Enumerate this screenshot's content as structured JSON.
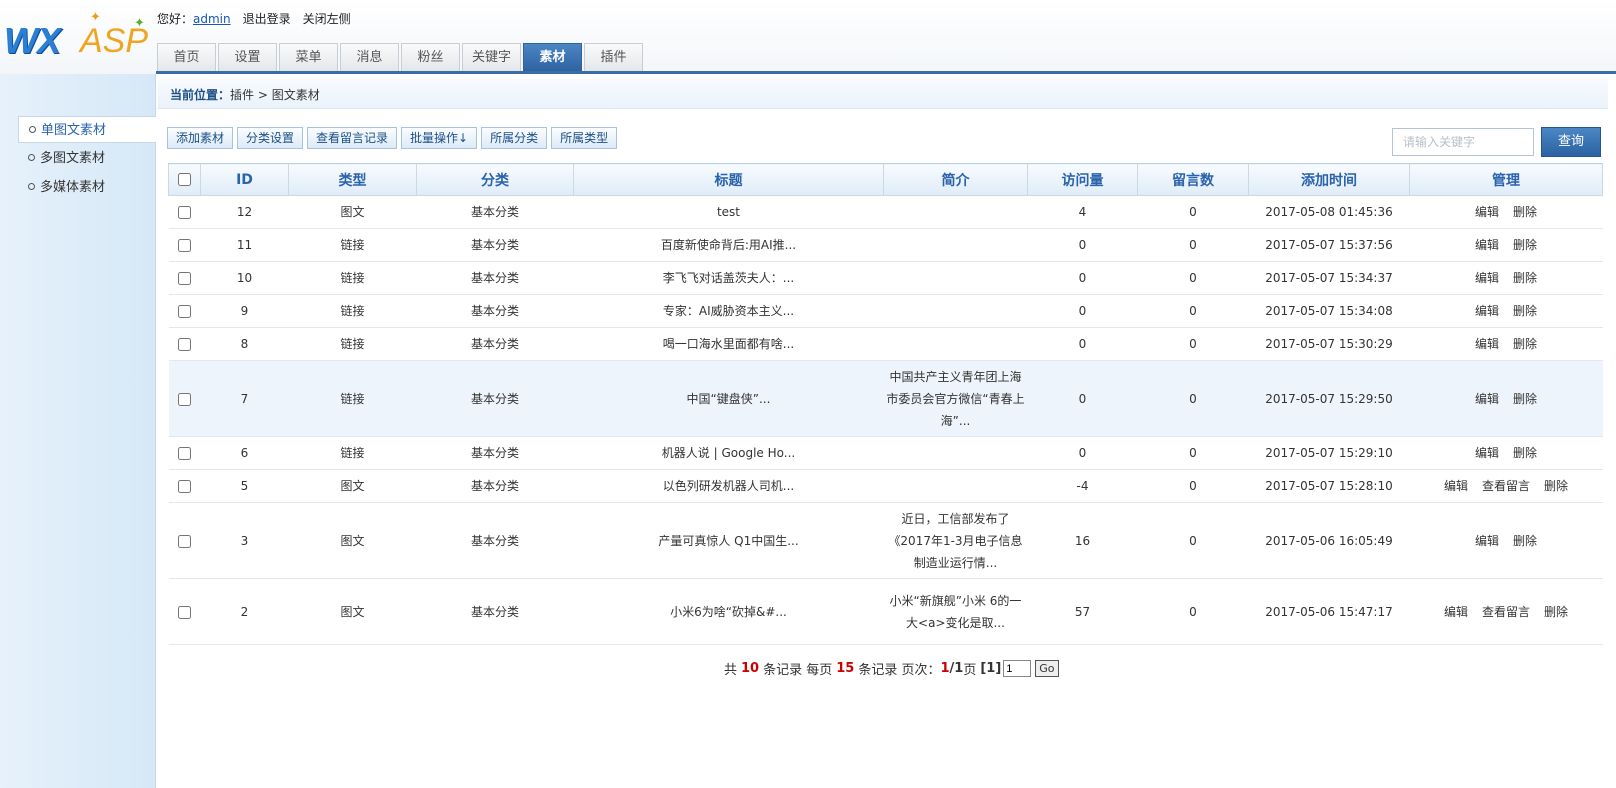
{
  "brand": {
    "logo_left": "WX",
    "logo_right": "ASP"
  },
  "user": {
    "greeting": "您好：",
    "username": "admin",
    "logout": "退出登录",
    "close_left": "关闭左侧"
  },
  "nav_tabs": [
    {
      "label": "首页"
    },
    {
      "label": "设置"
    },
    {
      "label": "菜单"
    },
    {
      "label": "消息"
    },
    {
      "label": "粉丝"
    },
    {
      "label": "关键字"
    },
    {
      "label": "素材",
      "active": true
    },
    {
      "label": "插件"
    }
  ],
  "sidebar": {
    "items": [
      {
        "label": "单图文素材",
        "active": true
      },
      {
        "label": "多图文素材"
      },
      {
        "label": "多媒体素材"
      }
    ]
  },
  "breadcrumb": {
    "label": "当前位置：",
    "path": "插件 > 图文素材"
  },
  "toolbar": {
    "buttons": [
      "添加素材",
      "分类设置",
      "查看留言记录",
      "批量操作↓",
      "所属分类",
      "所属类型"
    ]
  },
  "search": {
    "placeholder": "请输入关键字",
    "button": "查询"
  },
  "table": {
    "headers": [
      "ID",
      "类型",
      "分类",
      "标题",
      "简介",
      "访问量",
      "留言数",
      "添加时间",
      "管理"
    ],
    "rows": [
      {
        "id": "12",
        "type": "图文",
        "category": "基本分类",
        "title": "test",
        "desc": "",
        "views": "4",
        "comments": "0",
        "time": "2017-05-08 01:45:36",
        "actions": [
          "编辑",
          "删除"
        ]
      },
      {
        "id": "11",
        "type": "链接",
        "category": "基本分类",
        "title": "百度新使命背后:用AI推...",
        "desc": "",
        "views": "0",
        "comments": "0",
        "time": "2017-05-07 15:37:56",
        "actions": [
          "编辑",
          "删除"
        ]
      },
      {
        "id": "10",
        "type": "链接",
        "category": "基本分类",
        "title": "李飞飞对话盖茨夫人：...",
        "desc": "",
        "views": "0",
        "comments": "0",
        "time": "2017-05-07 15:34:37",
        "actions": [
          "编辑",
          "删除"
        ]
      },
      {
        "id": "9",
        "type": "链接",
        "category": "基本分类",
        "title": "专家：AI威胁资本主义...",
        "desc": "",
        "views": "0",
        "comments": "0",
        "time": "2017-05-07 15:34:08",
        "actions": [
          "编辑",
          "删除"
        ]
      },
      {
        "id": "8",
        "type": "链接",
        "category": "基本分类",
        "title": "喝一口海水里面都有啥...",
        "desc": "",
        "views": "0",
        "comments": "0",
        "time": "2017-05-07 15:30:29",
        "actions": [
          "编辑",
          "删除"
        ]
      },
      {
        "id": "7",
        "type": "链接",
        "category": "基本分类",
        "title": "中国“键盘侠”...",
        "desc": "中国共产主义青年团上海市委员会官方微信“青春上海”...",
        "views": "0",
        "comments": "0",
        "time": "2017-05-07 15:29:50",
        "actions": [
          "编辑",
          "删除"
        ],
        "highlight": true,
        "tall": true
      },
      {
        "id": "6",
        "type": "链接",
        "category": "基本分类",
        "title": "机器人说 | Google Ho...",
        "desc": "",
        "views": "0",
        "comments": "0",
        "time": "2017-05-07 15:29:10",
        "actions": [
          "编辑",
          "删除"
        ]
      },
      {
        "id": "5",
        "type": "图文",
        "category": "基本分类",
        "title": "以色列研发机器人司机...",
        "desc": "",
        "views": "-4",
        "comments": "0",
        "time": "2017-05-07 15:28:10",
        "actions": [
          "编辑",
          "查看留言",
          "删除"
        ]
      },
      {
        "id": "3",
        "type": "图文",
        "category": "基本分类",
        "title": "产量可真惊人 Q1中国生...",
        "desc": "近日，工信部发布了《2017年1-3月电子信息制造业运行情...",
        "views": "16",
        "comments": "0",
        "time": "2017-05-06 16:05:49",
        "actions": [
          "编辑",
          "删除"
        ],
        "tall": true
      },
      {
        "id": "2",
        "type": "图文",
        "category": "基本分类",
        "title": "小米6为啥“砍掉&#...",
        "desc": "小米“新旗舰”小米 6的一大<a>变化是取...",
        "views": "57",
        "comments": "0",
        "time": "2017-05-06 15:47:17",
        "actions": [
          "编辑",
          "查看留言",
          "删除"
        ],
        "mid": true
      }
    ]
  },
  "pager": {
    "total_prefix": "共",
    "total": "10",
    "total_suffix": "条记录 每页",
    "per_page": "15",
    "per_suffix": "条记录 页次：",
    "current": "1",
    "sep": "/",
    "pages": "1",
    "page_unit": "页",
    "links": "[1]",
    "input_value": "1",
    "go": "Go"
  }
}
